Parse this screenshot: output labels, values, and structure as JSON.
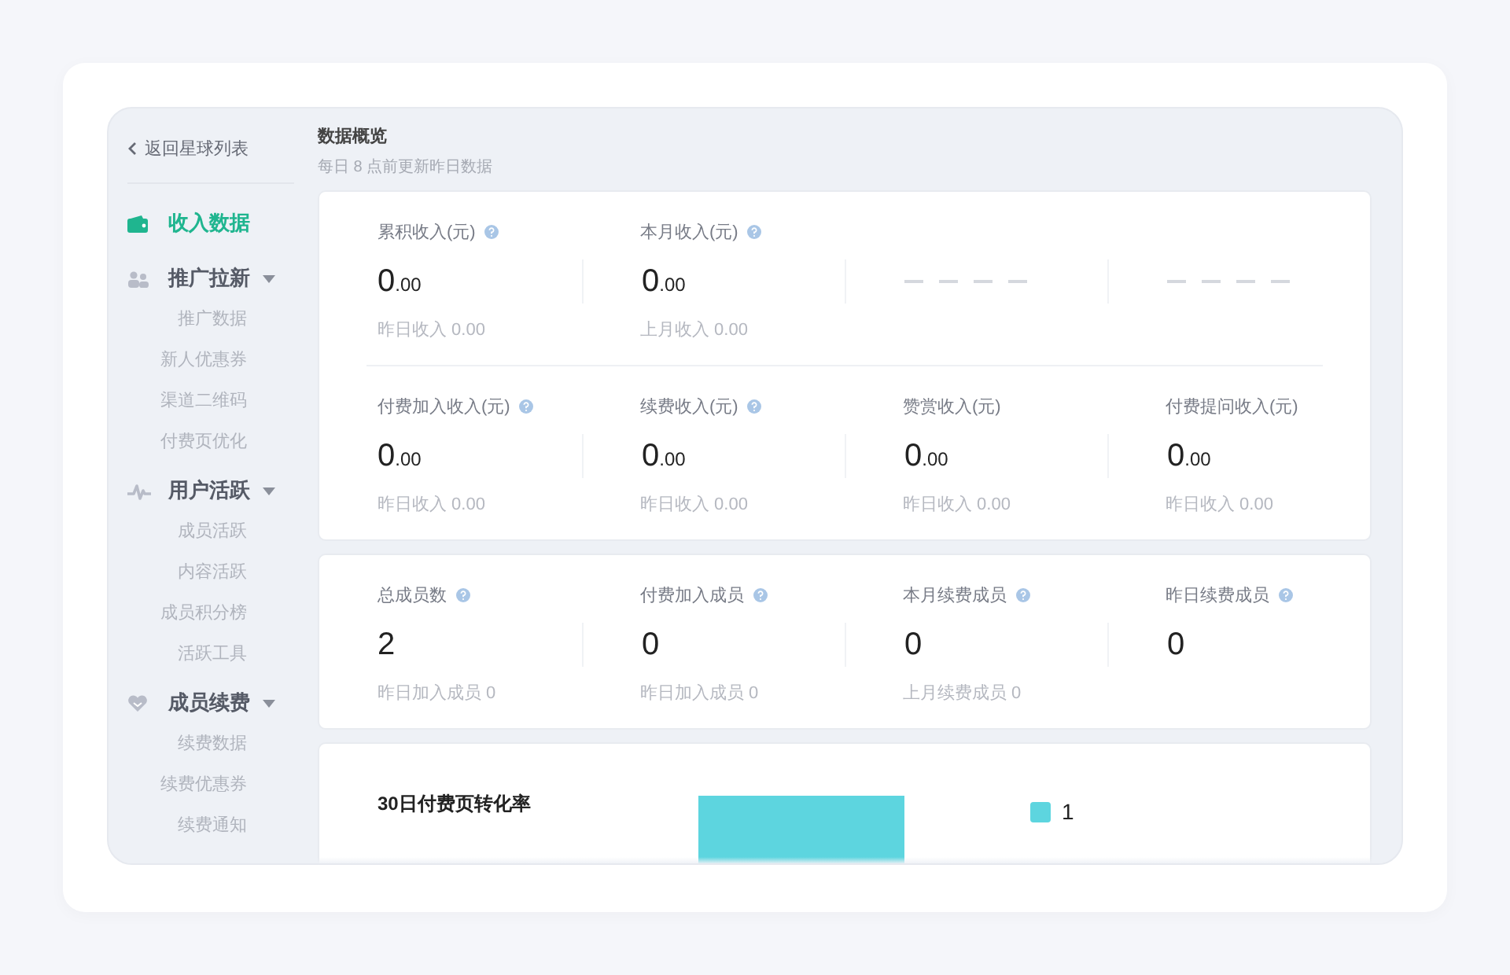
{
  "back_link": {
    "label": "返回星球列表"
  },
  "sidebar": {
    "sections": [
      {
        "label": "收入数据",
        "selected": true
      },
      {
        "label": "推广拉新",
        "selected": false,
        "expanded": true,
        "children": [
          {
            "label": "推广数据",
            "selected": false
          },
          {
            "label": "新人优惠券",
            "selected": false
          },
          {
            "label": "渠道二维码",
            "selected": false
          },
          {
            "label": "付费页优化",
            "selected": false
          }
        ]
      },
      {
        "label": "用户活跃",
        "selected": false,
        "expanded": true,
        "children": [
          {
            "label": "成员活跃",
            "selected": false
          },
          {
            "label": "内容活跃",
            "selected": false
          },
          {
            "label": "成员积分榜",
            "selected": false
          },
          {
            "label": "活跃工具",
            "selected": false
          }
        ]
      },
      {
        "label": "成员续费",
        "selected": false,
        "expanded": true,
        "children": [
          {
            "label": "续费数据",
            "selected": false
          },
          {
            "label": "续费优惠券",
            "selected": false
          },
          {
            "label": "续费通知",
            "selected": false
          }
        ]
      }
    ]
  },
  "header": {
    "title": "数据概览",
    "subtitle": "每日 8 点前更新昨日数据"
  },
  "revenue": {
    "rows": [
      [
        {
          "kind": "value",
          "label": "累积收入(元)",
          "help": true,
          "value": "0",
          "decimals": ".00",
          "footnote": "昨日收入 0.00"
        },
        {
          "kind": "value",
          "label": "本月收入(元)",
          "help": true,
          "value": "0",
          "decimals": ".00",
          "footnote": "上月收入 0.00"
        },
        {
          "kind": "empty"
        },
        {
          "kind": "empty"
        }
      ],
      [
        {
          "kind": "value",
          "label": "付费加入收入(元)",
          "help": true,
          "value": "0",
          "decimals": ".00",
          "footnote": "昨日收入 0.00"
        },
        {
          "kind": "value",
          "label": "续费收入(元)",
          "help": true,
          "value": "0",
          "decimals": ".00",
          "footnote": "昨日收入 0.00"
        },
        {
          "kind": "value",
          "label": "赞赏收入(元)",
          "value": "0",
          "decimals": ".00",
          "footnote": "昨日收入 0.00"
        },
        {
          "kind": "value",
          "label": "付费提问收入(元)",
          "value": "0",
          "decimals": ".00",
          "footnote": "昨日收入 0.00"
        }
      ]
    ]
  },
  "members": {
    "rows": [
      [
        {
          "kind": "value",
          "label": "总成员数",
          "help": true,
          "value": "2",
          "footnote": "昨日加入成员 0"
        },
        {
          "kind": "value",
          "label": "付费加入成员",
          "help": true,
          "value": "0",
          "footnote": "昨日加入成员 0"
        },
        {
          "kind": "value",
          "label": "本月续费成员",
          "help": true,
          "value": "0",
          "footnote": "上月续费成员 0"
        },
        {
          "kind": "value",
          "label": "昨日续费成员",
          "help": true,
          "value": "0"
        }
      ]
    ]
  },
  "conversion": {
    "title": "30日付费页转化率",
    "legend": [
      {
        "label": "1",
        "color": "#5dd5df"
      }
    ]
  }
}
